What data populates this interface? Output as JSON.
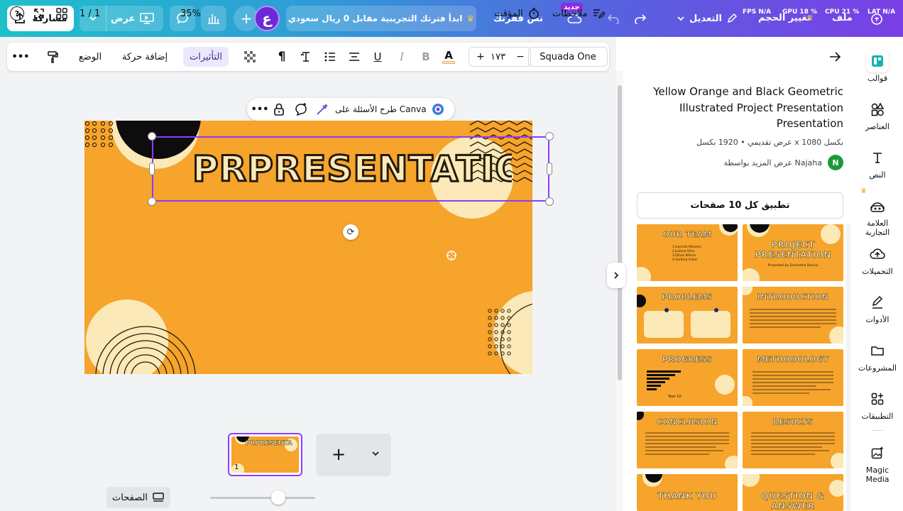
{
  "topbar": {
    "share_label": "مشاركة",
    "present_label": "عرض",
    "avatar_letter": "ع",
    "trial_text": "ابدأ فترتك التجريبية مقابل 0 ريال سعودي",
    "doc_name": "نص فقرتك",
    "new_badge": "جديد",
    "edit_label": "التعديل",
    "resize_label": "تغيير الحجم",
    "file_label": "ملف",
    "stat_fps": "FPS N/A",
    "stat_gpu": "GPU 18 %",
    "stat_cpu": "CPU 21 %",
    "stat_lat": "LAT N/A"
  },
  "toolbar": {
    "more_label": "•••",
    "position_label": "الوضع",
    "animate_label": "إضافة حركة",
    "effects_label": "التأثيرات",
    "font_size": "١٧٣",
    "size_minus": "−",
    "size_plus": "+",
    "font_name": "Squada One"
  },
  "floatbar": {
    "ask_label": "طرح الأسئلة على Canva",
    "more_label": "•••"
  },
  "slide": {
    "title_text": "PRPRESENTATION",
    "colors": {
      "bg": "#f6a42b",
      "cream": "#fbe9b8",
      "dark": "#231b0c"
    }
  },
  "thumbnail": {
    "page_number": "1",
    "title": "PRPRESENTA"
  },
  "bottombar": {
    "notes_label": "ملاحظات",
    "timer_label": "المؤقت",
    "zoom_label": "35%",
    "zoom_value": 0.35,
    "pages_label": "الصفحات",
    "page_counter": "1 / 1",
    "help_label": "?"
  },
  "panel": {
    "template_title": "Yellow Orange and Black Geometric Illustrated Project Presentation Presentation",
    "template_meta": "عرض تقديمي • 1920 بكسل x 1080 بكسل",
    "author_text": "عرض المزيد بواسطة Najaha",
    "author_initial": "N",
    "apply_label": "تطبيق كل 10 صفحات",
    "tiles": [
      {
        "title": "OUR TEAM"
      },
      {
        "title": "PROJECT PRESENTATION"
      },
      {
        "title": "PROBLEMS"
      },
      {
        "title": "INTRODUCTION"
      },
      {
        "title": "PROGRESS"
      },
      {
        "title": "METHODOLOGY"
      },
      {
        "title": "CONCLUSION"
      },
      {
        "title": "RESULTS"
      },
      {
        "title": "THANK YOU"
      },
      {
        "title": "QUESTION & ANSWER"
      }
    ],
    "tile_small_texts": {
      "team_lines": [
        "1.Hannah Morales",
        "2.Juliana Silva",
        "3.Olivia Wilson",
        "4.Sorbina Hakki"
      ],
      "project_sub": "Presented by Samantha Denica",
      "progress_note": "Year 10"
    }
  },
  "rail": [
    {
      "label": "قوالب",
      "icon": "templates-icon"
    },
    {
      "label": "العناصر",
      "icon": "elements-icon"
    },
    {
      "label": "النص",
      "icon": "text-icon"
    },
    {
      "label": "العلامة التجارية",
      "icon": "brand-icon"
    },
    {
      "label": "التحميلات",
      "icon": "uploads-icon"
    },
    {
      "label": "الأدوات",
      "icon": "tools-icon"
    },
    {
      "label": "المشروعات",
      "icon": "projects-icon"
    },
    {
      "label": "التطبيقات",
      "icon": "apps-icon"
    },
    {
      "label": "Magic Media",
      "icon": "magic-media-icon"
    }
  ]
}
